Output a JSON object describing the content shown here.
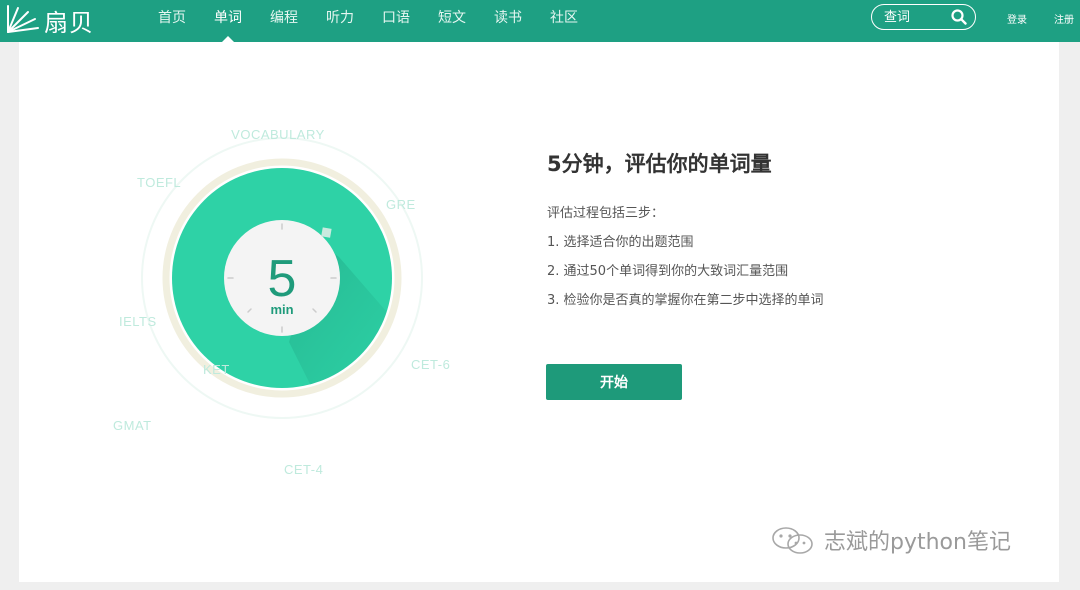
{
  "brand": {
    "logo_text": "扇贝"
  },
  "nav": {
    "items": [
      {
        "label": "首页",
        "active": false
      },
      {
        "label": "单词",
        "active": true
      },
      {
        "label": "编程",
        "active": false
      },
      {
        "label": "听力",
        "active": false
      },
      {
        "label": "口语",
        "active": false
      },
      {
        "label": "短文",
        "active": false
      },
      {
        "label": "读书",
        "active": false
      },
      {
        "label": "社区",
        "active": false
      }
    ]
  },
  "search": {
    "placeholder": "查词",
    "icon": "search-icon"
  },
  "auth": {
    "login_label": "登录",
    "register_label": "注册"
  },
  "illustration": {
    "timer_number": "5",
    "timer_unit": "min",
    "exam_labels": [
      "VOCABULARY",
      "GRE",
      "CET-6",
      "CET-4",
      "GMAT",
      "IELTS",
      "TOEFL",
      "KET"
    ]
  },
  "intro": {
    "title": "5分钟，评估你的单词量",
    "steps_intro": "评估过程包括三步：",
    "steps": [
      "1. 选择适合你的出题范围",
      "2. 通过50个单词得到你的大致词汇量范围",
      "3. 检验你是否真的掌握你在第二步中选择的单词"
    ],
    "start_label": "开始"
  },
  "watermark": {
    "text": "志斌的python笔记",
    "icon": "wechat-icon"
  },
  "colors": {
    "brand_green": "#1ea083",
    "button_green": "#1e9a7a",
    "dial_green": "#2ed2a6",
    "label_mint": "#bfeadd"
  }
}
